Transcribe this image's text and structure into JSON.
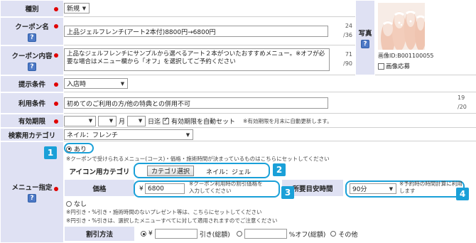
{
  "rows": {
    "type": {
      "label": "種別",
      "value": "新規"
    },
    "coupon_name": {
      "label": "クーポン名",
      "value": "上品ジェルフレンチ(アート2本付)8800円→6800円",
      "count": "24",
      "max": "/36"
    },
    "coupon_content": {
      "label": "クーポン内容",
      "value": "上品なジェルフレンチにサンプルから選べるアート２本がついたおすすめメニュー。※オフが必要な場合はメニュー欄から「オフ」を選択してご予約ください",
      "count": "71",
      "max": "/90"
    },
    "photo": {
      "label": "写真",
      "image_id": "画像ID:B001100055",
      "apply_label": "画像応募"
    },
    "conditions": {
      "label": "提示条件",
      "value": "入店時"
    },
    "usage": {
      "label": "利用条件",
      "value": "初めてのご利用の方/他の特典との併用不可",
      "count": "19",
      "max": "/20"
    },
    "expiry": {
      "label": "有効期限",
      "month_unit": "月",
      "day_unit": "日迄",
      "auto_label": "有効期限を自動セット",
      "note": "※有効期限を月末に自動更新します。"
    },
    "category": {
      "label": "検索用カテゴリ",
      "value": "ネイル：フレンチ"
    },
    "menu": {
      "label": "メニュー指定",
      "option_yes": "あり",
      "yes_note": "※クーポンで受けられるメニュー(コース)・価格・施術時間が決まっているものはこちらにセットしてください",
      "icon_category_label": "アイコン用カテゴリ",
      "category_button": "カテゴリ選択",
      "category_value": "ネイル：ジェル",
      "price_label": "価格",
      "yen": "¥",
      "price_value": "6800",
      "price_note": "※クーポン利用時の割引価格を入力してください",
      "time_label": "所要目安時間",
      "time_value": "90分",
      "time_note": "※予約時の時間計算に利用します",
      "option_no": "なし",
      "no_note1": "※円引き・%引き・施術時間のないプレゼント等は、こちらにセットしてください",
      "no_note2": "※円引き・%引きは、選択したメニューすべてに対して適用されますのでご注意ください",
      "discount_label": "割引方法",
      "discount_yen": "¥",
      "discount_yen_suffix": "引き(総額)",
      "discount_pct_suffix": "%オフ(総額)",
      "discount_other": "その他"
    }
  },
  "help_glyph": "?",
  "badges": [
    "1",
    "2",
    "3",
    "4"
  ],
  "colors": {
    "label_bg": "#dfe1f3",
    "required": "#e00000",
    "accent": "#1aa0d8",
    "help": "#4d79c6"
  }
}
